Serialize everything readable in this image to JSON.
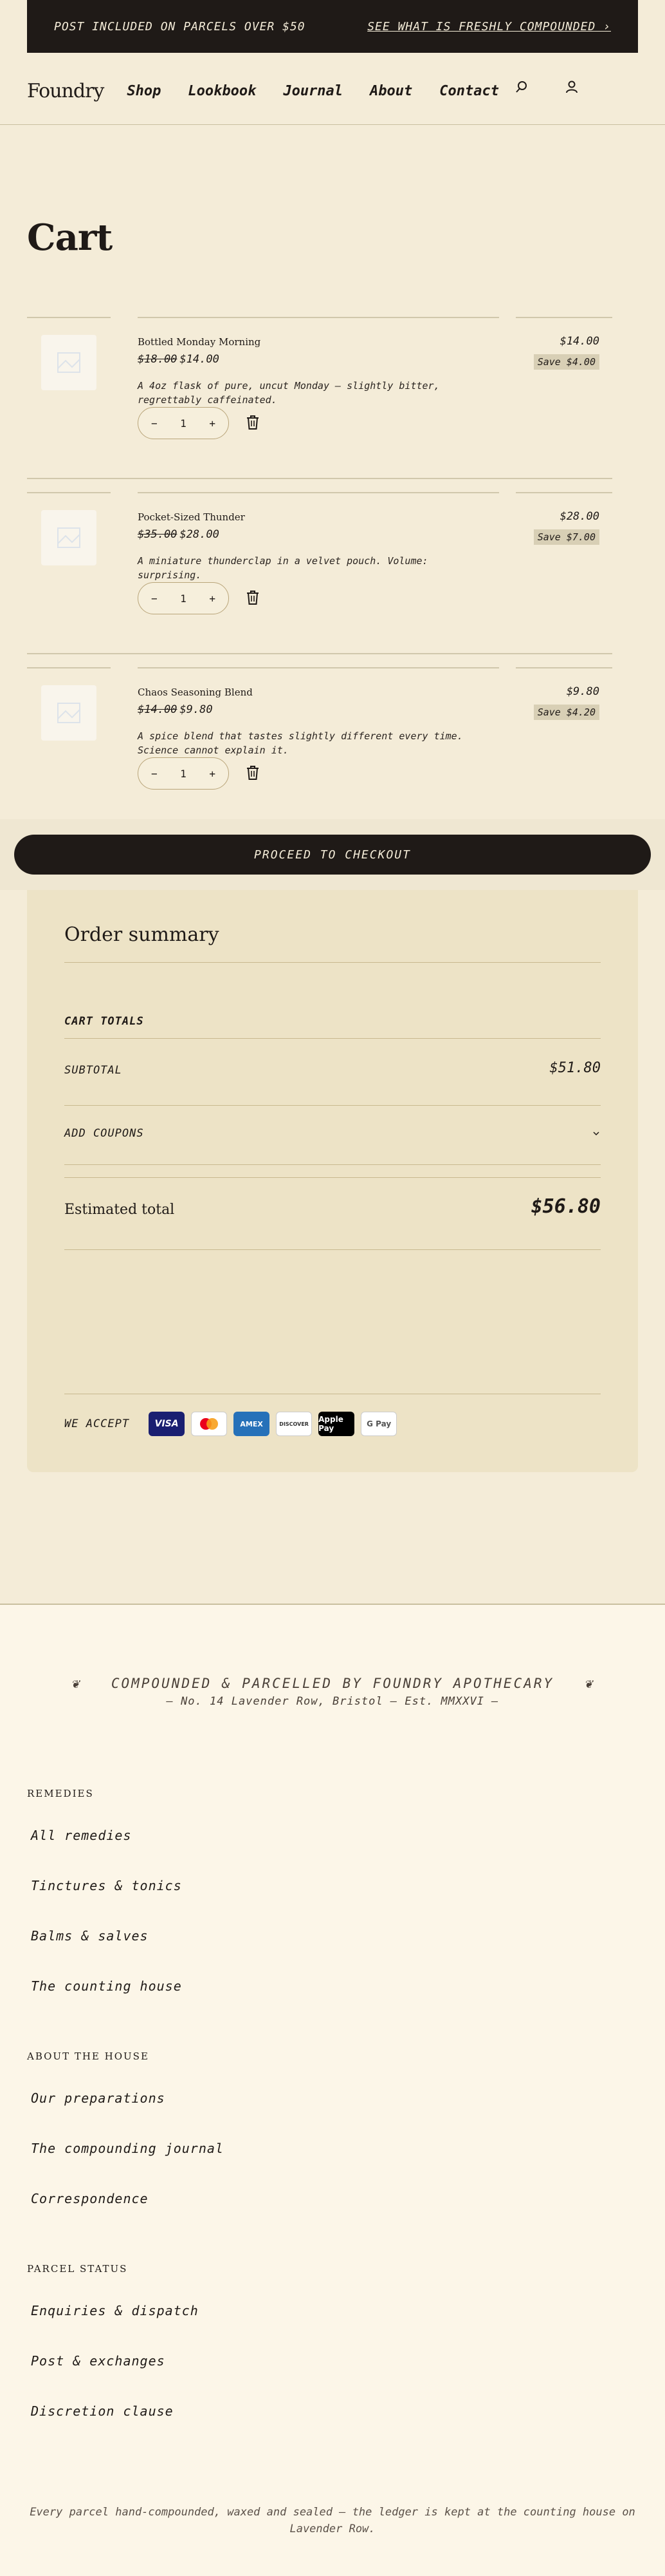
{
  "announcement": {
    "left": "POST INCLUDED ON PARCELS OVER $50",
    "right": "SEE WHAT IS FRESHLY COMPOUNDED ›"
  },
  "header": {
    "logo": "Foundry",
    "nav": [
      "Shop",
      "Lookbook",
      "Journal",
      "About",
      "Contact"
    ],
    "icons": [
      "search-icon",
      "account-icon"
    ]
  },
  "page": {
    "title": "Cart"
  },
  "cart": {
    "items": [
      {
        "name": "Bottled Monday Morning",
        "old_price": "$18.00",
        "price": "$14.00",
        "description": "A 4oz flask of pure, uncut Monday — slightly bitter, regrettably caffeinated.",
        "qty": "1",
        "total": "$14.00",
        "save": "Save $4.00"
      },
      {
        "name": "Pocket-Sized Thunder",
        "old_price": "$35.00",
        "price": "$28.00",
        "description": "A miniature thunderclap in a velvet pouch. Volume: surprising.",
        "qty": "1",
        "total": "$28.00",
        "save": "Save $7.00"
      },
      {
        "name": "Chaos Seasoning Blend",
        "old_price": "$14.00",
        "price": "$9.80",
        "description": "A spice blend that tastes slightly different every time. Science cannot explain it.",
        "qty": "1",
        "total": "$9.80",
        "save": "Save $4.20"
      }
    ],
    "minus": "−",
    "plus": "+"
  },
  "checkout": {
    "label": "PROCEED TO CHECKOUT"
  },
  "summary": {
    "title": "Order summary",
    "cart_totals": "CART TOTALS",
    "subtotal_label": "SUBTOTAL",
    "subtotal_value": "$51.80",
    "coupons_label": "ADD COUPONS",
    "estimated_label": "Estimated total",
    "estimated_value": "$56.80",
    "we_accept": "WE ACCEPT",
    "cards": [
      "VISA",
      "Mastercard",
      "AMEX",
      "DISCOVER",
      "Apple Pay",
      "G Pay"
    ]
  },
  "footer": {
    "crest": "COMPOUNDED & PARCELLED BY FOUNDRY APOTHECARY",
    "address": "— No. 14 Lavender Row, Bristol — Est. MMXXVI —",
    "sections": [
      {
        "title": "REMEDIES",
        "links": [
          "All remedies",
          "Tinctures & tonics",
          "Balms & salves",
          "The counting house"
        ]
      },
      {
        "title": "ABOUT THE HOUSE",
        "links": [
          "Our preparations",
          "The compounding journal",
          "Correspondence"
        ]
      },
      {
        "title": "PARCEL STATUS",
        "links": [
          "Enquiries & dispatch",
          "Post & exchanges",
          "Discretion clause"
        ]
      }
    ],
    "fine_print": "Every parcel hand-compounded, waxed and sealed — the ledger is kept at the counting house on Lavender Row."
  }
}
